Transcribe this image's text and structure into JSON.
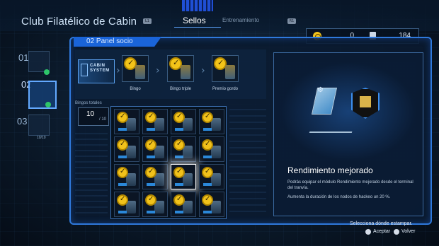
{
  "header": {
    "title": "Club Filatélico de Cabin",
    "l1_badge": "L1",
    "r1_badge": "R1",
    "tabs": [
      {
        "label": "Sellos",
        "active": true
      },
      {
        "label": "Entrenamiento",
        "active": false
      }
    ]
  },
  "currency": {
    "stamps_count": "0",
    "chips_count": "184"
  },
  "sidebar": {
    "items": [
      {
        "num": "01",
        "completed": true
      },
      {
        "num": "02",
        "completed": true,
        "active": true
      },
      {
        "num": "03",
        "progress": "10/10"
      }
    ]
  },
  "panel": {
    "title": "02 Panel socio",
    "brand": "CABIN\nSYSTEM",
    "rewards": [
      {
        "caption": "Bingo"
      },
      {
        "caption": "Bingo triple"
      },
      {
        "caption": "Premio gordo"
      }
    ],
    "bingos": {
      "label": "Bingos totales",
      "value": "10",
      "denominator": "/ 10"
    },
    "grid": {
      "rows": 4,
      "cols": 4,
      "stamped_all": true,
      "cursor_row": 2,
      "cursor_col": 2
    }
  },
  "detail": {
    "title": "Rendimiento mejorado",
    "description": "Podrás equipar el módulo Rendimiento mejorado desde el terminal del tranvía.",
    "effect": "Aumenta la duración de los nodos de hackeo un 20 %."
  },
  "footer": {
    "hint": "Selecciona dónde estampar.",
    "accept_label": "Aceptar",
    "back_label": "Volver"
  },
  "colors": {
    "accent": "#2f79dc",
    "stamp": "#f1c21b",
    "check": "#2ec56a"
  }
}
